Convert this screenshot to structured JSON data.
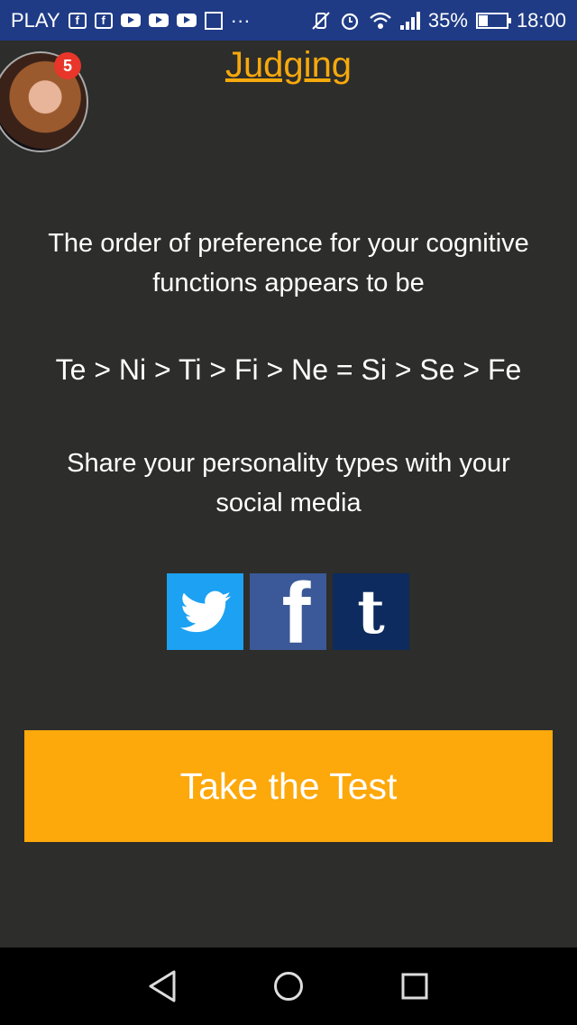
{
  "status_bar": {
    "carrier": "PLAY",
    "overflow": "···",
    "battery_percent": "35%",
    "battery_level": 0.35,
    "time": "18:00",
    "notification_icons": [
      "facebook-icon",
      "facebook-icon",
      "youtube-icon",
      "youtube-icon",
      "youtube-icon",
      "gallery-icon"
    ]
  },
  "header": {
    "title": "Judging",
    "badge_count": "5"
  },
  "content": {
    "description": "The order of preference for your cognitive functions appears to be",
    "function_order": "Te > Ni > Ti > Fi > Ne = Si > Se > Fe",
    "share_prompt": "Share your personality types with your social media"
  },
  "social": {
    "facebook_glyph": "f",
    "tumblr_glyph": "t",
    "colors": {
      "twitter": "#1da1f2",
      "facebook": "#3b5998",
      "tumblr": "#0d2b5e"
    }
  },
  "cta": {
    "label": "Take the Test",
    "color": "#fda80b"
  },
  "theme": {
    "background": "#2d2d2b",
    "accent": "#f6a90c",
    "status_bar": "#1f3b86"
  }
}
